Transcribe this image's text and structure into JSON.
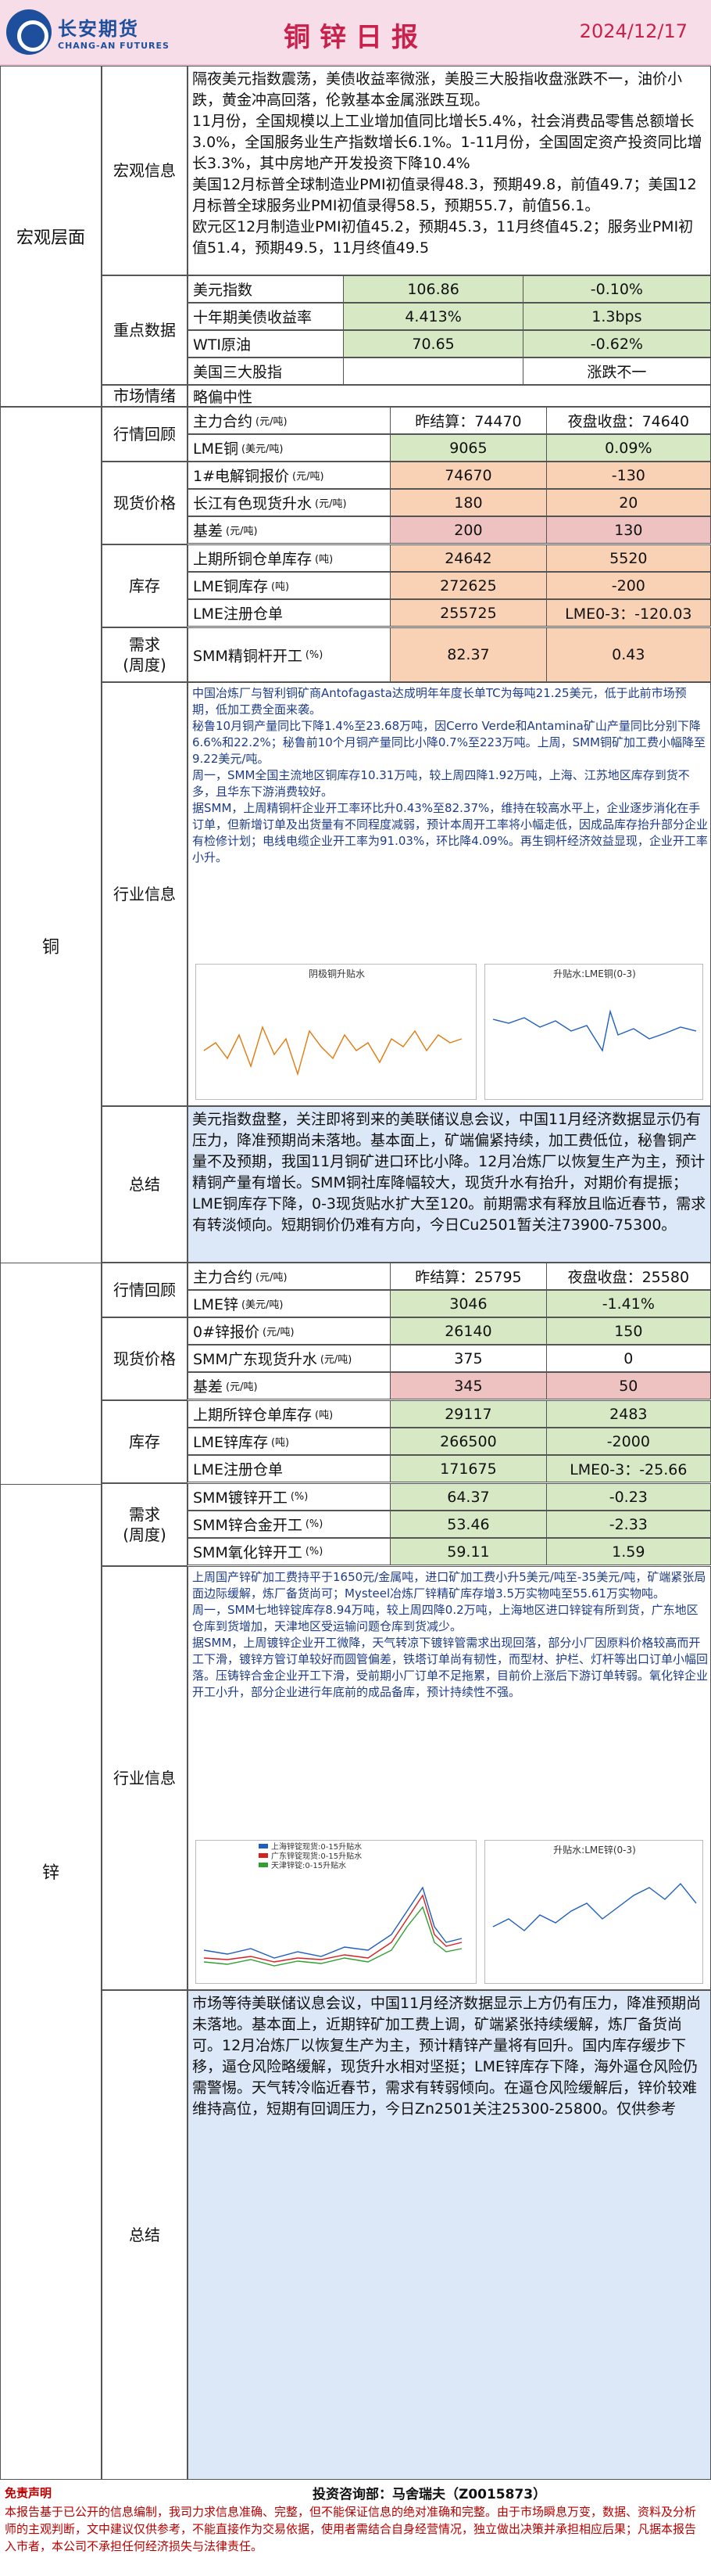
{
  "header": {
    "logo_cn": "长安期货",
    "logo_en": "CHANG-AN FUTURES",
    "title": "铜锌日报",
    "date": "2024/12/17"
  },
  "macro": {
    "section": "宏观层面",
    "info_label": "宏观信息",
    "info_text": "隔夜美元指数震荡，美债收益率微涨，美股三大股指收盘涨跌不一，油价小跌，黄金冲高回落，伦敦基本金属涨跌互现。\n11月份，全国规模以上工业增加值同比增长5.4%，社会消费品零售总额增长3.0%，全国服务业生产指数增长6.1%。1-11月份，全国固定资产投资同比增长3.3%，其中房地产开发投资下降10.4%\n美国12月标普全球制造业PMI初值录得48.3，预期49.8，前值49.7；美国12月标普全球服务业PMI初值录得58.5，预期55.7，前值56.1。\n欧元区12月制造业PMI初值45.2，预期45.3，11月终值45.2；服务业PMI初值51.4，预期49.5，11月终值49.5",
    "key_label": "重点数据",
    "key_rows": [
      {
        "name": "美元指数",
        "v1": "106.86",
        "v2": "-0.10%"
      },
      {
        "name": "十年期美债收益率",
        "v1": "4.413%",
        "v2": "1.3bps"
      },
      {
        "name": "WTI原油",
        "v1": "70.65",
        "v2": "-0.62%"
      },
      {
        "name": "美国三大股指",
        "v1": "",
        "v2": "涨跌不一"
      }
    ],
    "mood_label": "市场情绪",
    "mood_value": "略偏中性"
  },
  "copper": {
    "section": "铜",
    "review_label": "行情回顾",
    "review": [
      {
        "name": "主力合约",
        "unit": "(元/吨)",
        "v1": "昨结算：74470",
        "v2": "夜盘收盘：74640"
      },
      {
        "name": "LME铜",
        "unit": "(美元/吨)",
        "v1": "9065",
        "v2": "0.09%"
      }
    ],
    "spot_label": "现货价格",
    "spot": [
      {
        "name": "1#电解铜报价",
        "unit": "(元/吨)",
        "v1": "74670",
        "v2": "-130"
      },
      {
        "name": "长江有色现货升水",
        "unit": "(元/吨)",
        "v1": "180",
        "v2": "20"
      },
      {
        "name": "基差",
        "unit": "(元/吨)",
        "v1": "200",
        "v2": "130"
      }
    ],
    "stock_label": "库存",
    "stock": [
      {
        "name": "上期所铜仓单库存",
        "unit": "(吨)",
        "v1": "24642",
        "v2": "5520"
      },
      {
        "name": "LME铜库存",
        "unit": "(吨)",
        "v1": "272625",
        "v2": "-200"
      },
      {
        "name": "LME注册仓单",
        "unit": "",
        "v1": "255725",
        "v2": "LME0-3：-120.03"
      }
    ],
    "demand_label": "需求\n(周度)",
    "demand": [
      {
        "name": "SMM精铜杆开工",
        "unit": "(%)",
        "v1": "82.37",
        "v2": "0.43"
      }
    ],
    "industry_label": "行业信息",
    "industry_text": "中国冶炼厂与智利铜矿商Antofagasta达成明年年度长单TC为每吨21.25美元，低于此前市场预期，低加工费全面来袭。\n秘鲁10月铜产量同比下降1.4%至23.68万吨，因Cerro Verde和Antamina矿山产量同比分别下降6.6%和22.2%；秘鲁前10个月铜产量同比小降0.7%至223万吨。上周，SMM铜矿加工费小幅降至9.22美元/吨。\n周一，SMM全国主流地区铜库存10.31万吨，较上周四降1.92万吨，上海、江苏地区库存到货不多，且华东下游消费较好。\n据SMM，上周精铜杆企业开工率环比升0.43%至82.37%，维持在较高水平上，企业逐步消化在手订单，但新增订单及出货量有不同程度减弱，预计本周开工率将小幅走低，因成品库存抬升部分企业有检修计划；电线电缆企业开工率为91.03%，环比降4.09%。再生铜杆经济效益显现，企业开工率小升。",
    "chart1_title": "阴极铜升贴水",
    "chart2_title": "升贴水:LME铜(0-3)",
    "summary_label": "总结",
    "summary_text": "美元指数盘整，关注即将到来的美联储议息会议，中国11月经济数据显示仍有压力，降准预期尚未落地。基本面上，矿端偏紧持续，加工费低位，秘鲁铜产量不及预期，我国11月铜矿进口环比小降。12月冶炼厂以恢复生产为主，预计精铜产量有增长。SMM铜社库降幅较大，现货升水有抬升，对期价有提振；LME铜库存下降，0-3现货贴水扩大至120。前期需求有释放且临近春节，需求有转淡倾向。短期铜价仍难有方向，今日Cu2501暂关注73900-75300。"
  },
  "zinc": {
    "section": "锌",
    "review_label": "行情回顾",
    "review": [
      {
        "name": "主力合约",
        "unit": "(元/吨)",
        "v1": "昨结算：25795",
        "v2": "夜盘收盘：25580"
      },
      {
        "name": "LME锌",
        "unit": "(美元/吨)",
        "v1": "3046",
        "v2": "-1.41%"
      }
    ],
    "spot_label": "现货价格",
    "spot": [
      {
        "name": "0#锌报价",
        "unit": "(元/吨)",
        "v1": "26140",
        "v2": "150"
      },
      {
        "name": "SMM广东现货升水",
        "unit": "(元/吨)",
        "v1": "375",
        "v2": "0"
      },
      {
        "name": "基差",
        "unit": "(元/吨)",
        "v1": "345",
        "v2": "50"
      }
    ],
    "stock_label": "库存",
    "stock": [
      {
        "name": "上期所锌仓单库存",
        "unit": "(吨)",
        "v1": "29117",
        "v2": "2483"
      },
      {
        "name": "LME锌库存",
        "unit": "(吨)",
        "v1": "266500",
        "v2": "-2000"
      },
      {
        "name": "LME注册仓单",
        "unit": "",
        "v1": "171675",
        "v2": "LME0-3：-25.66"
      }
    ],
    "demand_label": "需求\n(周度)",
    "demand": [
      {
        "name": "SMM镀锌开工",
        "unit": "(%)",
        "v1": "64.37",
        "v2": "-0.23"
      },
      {
        "name": "SMM锌合金开工",
        "unit": "(%)",
        "v1": "53.46",
        "v2": "-2.33"
      },
      {
        "name": "SMM氧化锌开工",
        "unit": "(%)",
        "v1": "59.11",
        "v2": "1.59"
      }
    ],
    "industry_label": "行业信息",
    "industry_text": "上周国产锌矿加工费持平于1650元/金属吨，进口矿加工费小升5美元/吨至-35美元/吨，矿端紧张局面边际缓解，炼厂备货尚可；Mysteel冶炼厂锌精矿库存增3.5万实物吨至55.61万实物吨。\n周一，SMM七地锌锭库存8.94万吨，较上周四降0.2万吨，上海地区进口锌锭有所到货，广东地区仓库到货增加，天津地区受运输问题仓库到货减少。\n据SMM，上周镀锌企业开工微降，天气转凉下镀锌管需求出现回落，部分小厂因原料价格较高而开工下滑，镀锌方管订单较好而圆管偏差，铁塔订单尚有韧性，而型材、护栏、灯杆等出口订单小幅回落。压铸锌合金企业开工下滑，受前期小厂订单不足拖累，目前价上涨后下游订单转弱。氧化锌企业开工小升，部分企业进行年底前的成品备库，预计持续性不强。",
    "chart1_legend": [
      "上海锌锭现货:0-15升贴水",
      "广东锌锭现货:0-15升贴水",
      "天津锌锭:0-15升贴水"
    ],
    "chart2_title": "升贴水:LME锌(0-3)",
    "summary_label": "总结",
    "summary_text": "市场等待美联储议息会议，中国11月经济数据显示上方仍有压力，降准预期尚未落地。基本面上，近期锌矿加工费上调，矿端紧张持续缓解，炼厂备货尚可。12月冶炼厂以恢复生产为主，预计精锌产量将有回升。国内库存缓步下移，逼仓风险略缓解，现货升水相对坚挺；LME锌库存下降，海外逼仓风险仍需警惕。天气转冷临近春节，需求有转弱倾向。在逼仓风险缓解后，锌价较难维持高位，短期有回调压力，今日Zn2501关注25300-25800。仅供参考"
  },
  "footer": {
    "source": "投资咨询部：马舍瑞夫（Z0015873）",
    "disclaimer_title": "免责声明",
    "disclaimer": "本报告基于已公开的信息编制，我司力求信息准确、完整，但不能保证信息的绝对准确和完整。由于市场瞬息万变，数据、资料及分析师的主观判断，文中建议仅供参考，不能直接作为交易依据，使用者需结合自身经营情况，独立做出决策并承担相应后果；凡据本报告入市者，本公司不承担任何经济损失与法律责任。"
  }
}
